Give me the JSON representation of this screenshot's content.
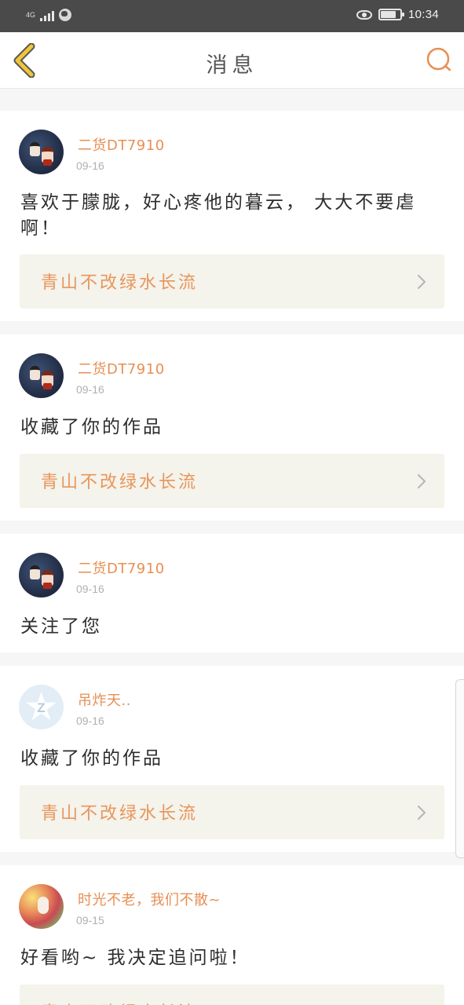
{
  "status_bar": {
    "network": "4G",
    "time": "10:34",
    "icons": [
      "signal-icon",
      "globe-icon",
      "eye-comfort-icon",
      "battery-icon"
    ]
  },
  "header": {
    "title": "消息",
    "back_icon": "chevron-left-icon",
    "search_icon": "search-icon"
  },
  "colors": {
    "accent": "#e88f53",
    "back_icon": "#f0c53a",
    "card_bg": "#f4f3ec",
    "page_bg": "#f6f6f6"
  },
  "messages": [
    {
      "user": "二货DT7910",
      "date": "09-16",
      "text": "喜欢于朦胧，好心疼他的暮云， 大大不要虐啊！",
      "work": "青山不改绿水长流",
      "avatar": "anime-avatar"
    },
    {
      "user": "二货DT7910",
      "date": "09-16",
      "text": "收藏了你的作品",
      "work": "青山不改绿水长流",
      "avatar": "anime-avatar"
    },
    {
      "user": "二货DT7910",
      "date": "09-16",
      "text": "关注了您",
      "avatar": "anime-avatar"
    },
    {
      "user": "吊炸天..",
      "date": "09-16",
      "text": "收藏了你的作品",
      "work": "青山不改绿水长流",
      "avatar": "qq-default-avatar"
    },
    {
      "user": "时光不老，我们不散~",
      "date": "09-15",
      "text": "好看哟~ 我决定追问啦！",
      "work": "青山不改绿水长流",
      "avatar": "colorful-avatar"
    }
  ]
}
